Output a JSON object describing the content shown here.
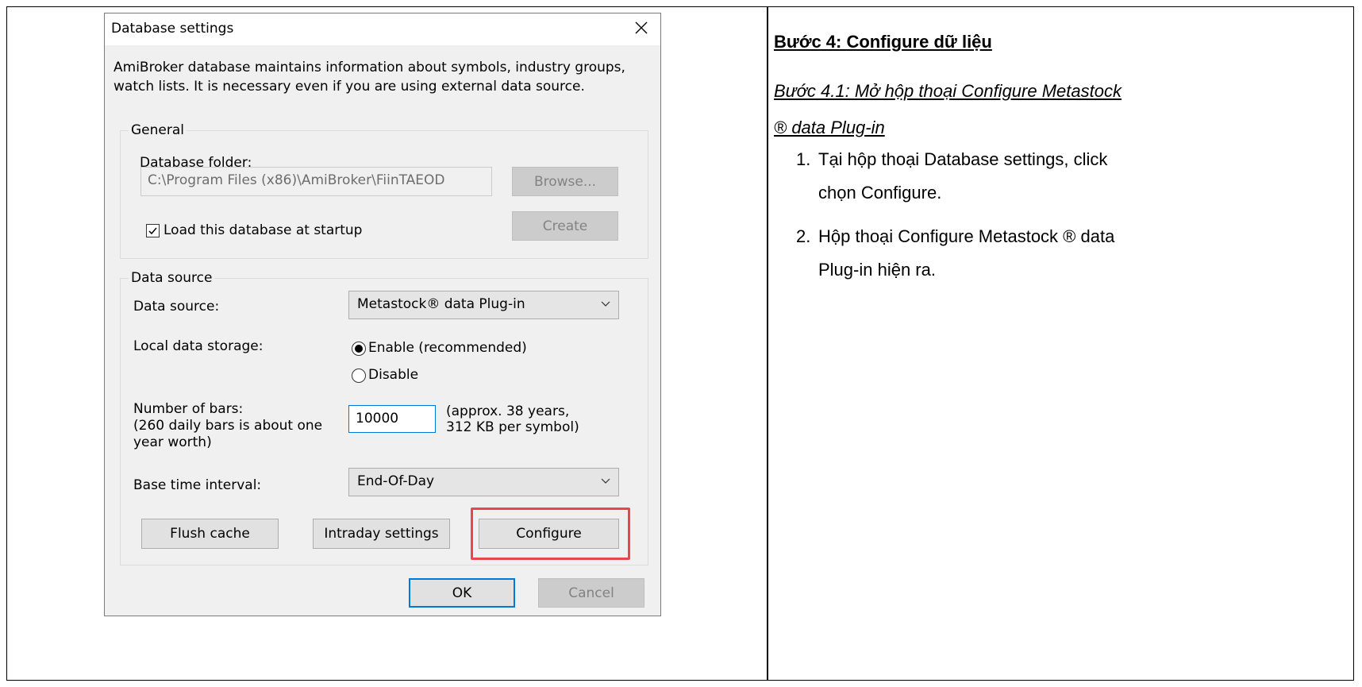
{
  "dialog": {
    "title": "Database settings",
    "description": "AmiBroker database maintains information about symbols, industry groups, watch lists. It is necessary even if you are using external data source.",
    "general": {
      "legend": "General",
      "folder_label": "Database folder:",
      "folder_value": "C:\\Program Files (x86)\\AmiBroker\\FiinTAEOD",
      "browse_label": "Browse...",
      "create_label": "Create",
      "load_at_startup_label": "Load this database at startup",
      "load_at_startup_checked": true
    },
    "data_source": {
      "legend": "Data source",
      "source_label": "Data source:",
      "source_value": "Metastock® data Plug-in",
      "storage_label": "Local data storage:",
      "enable_label": "Enable (recommended)",
      "disable_label": "Disable",
      "enable_selected": true,
      "bars_label_1": "Number of bars:",
      "bars_label_2": "(260 daily bars is about one",
      "bars_label_3": "year worth)",
      "bars_value": "10000",
      "bars_note_1": "(approx. 38 years,",
      "bars_note_2": "312 KB per symbol)",
      "interval_label": "Base time interval:",
      "interval_value": "End-Of-Day",
      "flush_label": "Flush cache",
      "intraday_label": "Intraday settings",
      "configure_label": "Configure"
    },
    "ok_label": "OK",
    "cancel_label": "Cancel",
    "highlight_color": "#e8474f"
  },
  "instructions": {
    "heading": "Bước 4: Configure dữ liệu",
    "subheading_line1": "Bước 4.1: Mở hộp thoại Configure Metastock",
    "subheading_line2": "® data Plug-in",
    "steps": [
      {
        "number": "1.",
        "line1": "Tại hộp thoại Database settings, click",
        "line2": "chọn Configure."
      },
      {
        "number": "2.",
        "line1": "Hộp thoại Configure Metastock ® data",
        "line2": "Plug-in hiện ra."
      }
    ]
  }
}
